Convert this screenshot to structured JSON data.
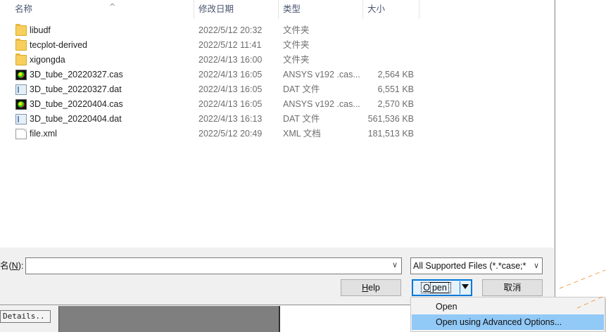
{
  "columns": {
    "name": "名称",
    "date": "修改日期",
    "type": "类型",
    "size": "大小"
  },
  "files": [
    {
      "name": "libudf",
      "date": "2022/5/12 20:32",
      "type": "文件夹",
      "size": "",
      "icon": "folder-icon"
    },
    {
      "name": "tecplot-derived",
      "date": "2022/5/12 11:41",
      "type": "文件夹",
      "size": "",
      "icon": "folder-icon"
    },
    {
      "name": "xigongda",
      "date": "2022/4/13 16:00",
      "type": "文件夹",
      "size": "",
      "icon": "folder-icon"
    },
    {
      "name": "3D_tube_20220327.cas",
      "date": "2022/4/13 16:05",
      "type": "ANSYS v192 .cas...",
      "size": "2,564 KB",
      "icon": "cas-file-icon"
    },
    {
      "name": "3D_tube_20220327.dat",
      "date": "2022/4/13 16:05",
      "type": "DAT 文件",
      "size": "6,551 KB",
      "icon": "dat-file-icon"
    },
    {
      "name": "3D_tube_20220404.cas",
      "date": "2022/4/13 16:05",
      "type": "ANSYS v192 .cas...",
      "size": "2,570 KB",
      "icon": "cas-file-icon"
    },
    {
      "name": "3D_tube_20220404.dat",
      "date": "2022/4/13 16:13",
      "type": "DAT 文件",
      "size": "561,536 KB",
      "icon": "dat-file-icon"
    },
    {
      "name": "file.xml",
      "date": "2022/5/12 20:49",
      "type": "XML 文档",
      "size": "181,513 KB",
      "icon": "xml-file-icon"
    }
  ],
  "filename": {
    "label_prefix": "名(",
    "label_key": "N",
    "label_suffix": "):",
    "value": ""
  },
  "filetype": {
    "selected": "All Supported Files (*.*case;*"
  },
  "buttons": {
    "help_key": "H",
    "help_rest": "elp",
    "open_key": "O",
    "open_rest": "pen",
    "cancel": "取消"
  },
  "dropdown": {
    "items": [
      "Open",
      "Open using Advanced Options..."
    ]
  },
  "details_label": "Details..",
  "colors": {
    "accent": "#0078d7",
    "menu_highlight": "#91c9f7",
    "deco_orange": "#f0a050"
  }
}
